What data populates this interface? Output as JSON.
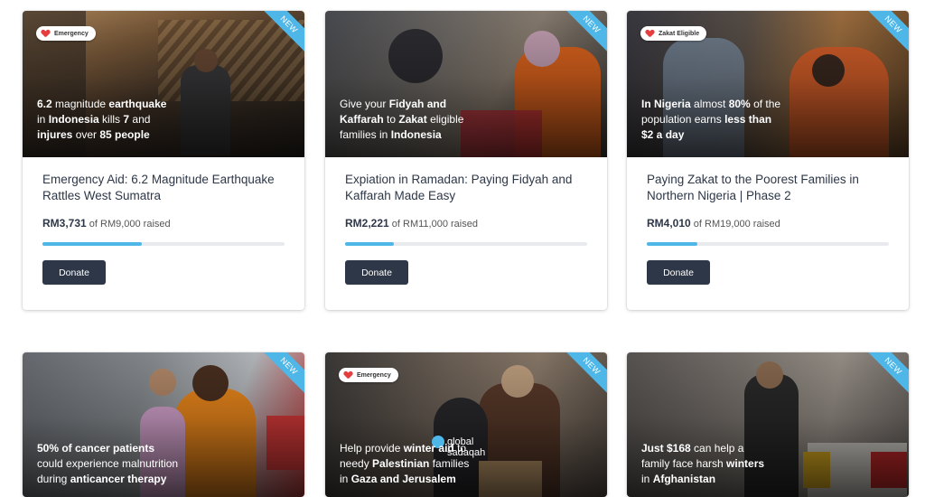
{
  "cards": [
    {
      "badge": "Emergency",
      "ribbon": "NEW",
      "overlay": [
        "6.2 magnitude earthquake",
        "in Indonesia kills 7 and",
        "injures over 85 people"
      ],
      "title": "Emergency Aid: 6.2 Magnitude Earthquake Rattles West Sumatra",
      "amount": "RM3,731",
      "goal_text": "of RM9,000 raised",
      "progress_fraction": 0.41,
      "button": "Donate"
    },
    {
      "ribbon": "NEW",
      "overlay": [
        "Give your Fidyah and",
        "Kaffarah to Zakat eligible",
        "families in Indonesia"
      ],
      "title": "Expiation in Ramadan: Paying Fidyah and Kaffarah Made Easy",
      "amount": "RM2,221",
      "goal_text": "of RM11,000 raised",
      "progress_fraction": 0.2,
      "button": "Donate"
    },
    {
      "badge": "Zakat Eligible",
      "ribbon": "NEW",
      "overlay": [
        "In Nigeria almost 80% of the",
        "population earns less than",
        "$2 a day"
      ],
      "title": "Paying Zakat to the Poorest Families in Northern Nigeria | Phase 2",
      "amount": "RM4,010",
      "goal_text": "of RM19,000 raised",
      "progress_fraction": 0.21,
      "button": "Donate"
    },
    {
      "ribbon": "NEW",
      "overlay": [
        "50% of cancer patients",
        "could experience malnutrition",
        "during anticancer therapy"
      ]
    },
    {
      "badge": "Emergency",
      "ribbon": "NEW",
      "overlay": [
        "Help provide winter aid to",
        "needy Palestinian families",
        "in Gaza and Jerusalem"
      ],
      "logo": [
        "global",
        "sadaqah"
      ]
    },
    {
      "ribbon": "NEW",
      "overlay": [
        "Just $168 can help a",
        "family face harsh winters",
        "in Afghanistan"
      ]
    }
  ],
  "colors": {
    "accent": "#4fb7e8",
    "button": "#2d3748",
    "badge_heart": "#e53e3e"
  }
}
